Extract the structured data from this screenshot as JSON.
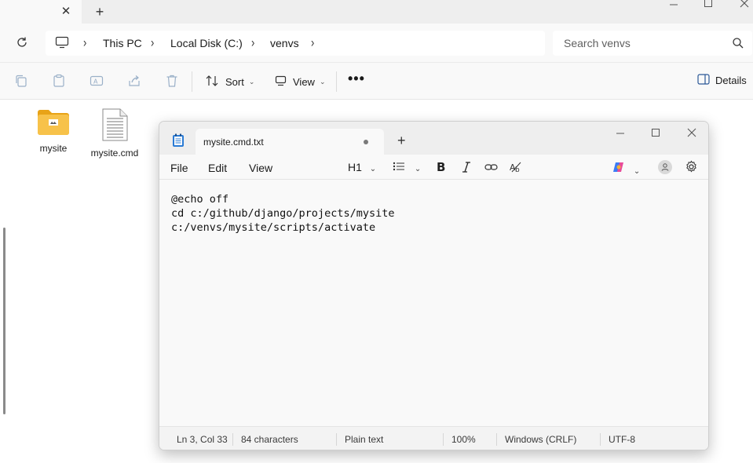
{
  "explorer": {
    "new_tab_symbol": "+",
    "close_tab_symbol": "✕",
    "breadcrumb": [
      "This PC",
      "Local Disk (C:)",
      "venvs"
    ],
    "search_placeholder": "Search venvs",
    "toolbar": {
      "sort_label": "Sort",
      "view_label": "View",
      "more_label": "•••",
      "details_label": "Details",
      "icons": [
        "copy-icon",
        "paste-icon",
        "rename-icon",
        "share-icon",
        "delete-icon"
      ]
    },
    "files": [
      {
        "name": "mysite",
        "type": "folder"
      },
      {
        "name": "mysite.cmd",
        "type": "text-file"
      }
    ]
  },
  "notepad": {
    "tab_title": "mysite.cmd.txt",
    "new_tab_symbol": "+",
    "menu": [
      "File",
      "Edit",
      "View"
    ],
    "format": {
      "heading_label": "H1"
    },
    "content_lines": [
      "@echo off",
      "cd c:/github/django/projects/mysite",
      "c:/venvs/mysite/scripts/activate"
    ],
    "status": {
      "position": "Ln 3, Col 33",
      "characters": "84 characters",
      "format": "Plain text",
      "zoom": "100%",
      "line_ending": "Windows (CRLF)",
      "encoding": "UTF-8"
    }
  },
  "colors": {
    "folder_yellow": "#f7c24a",
    "bg_light": "#f9f9f9",
    "copilot_blue": "#3a7bf5",
    "copilot_pink": "#e84a9a"
  }
}
